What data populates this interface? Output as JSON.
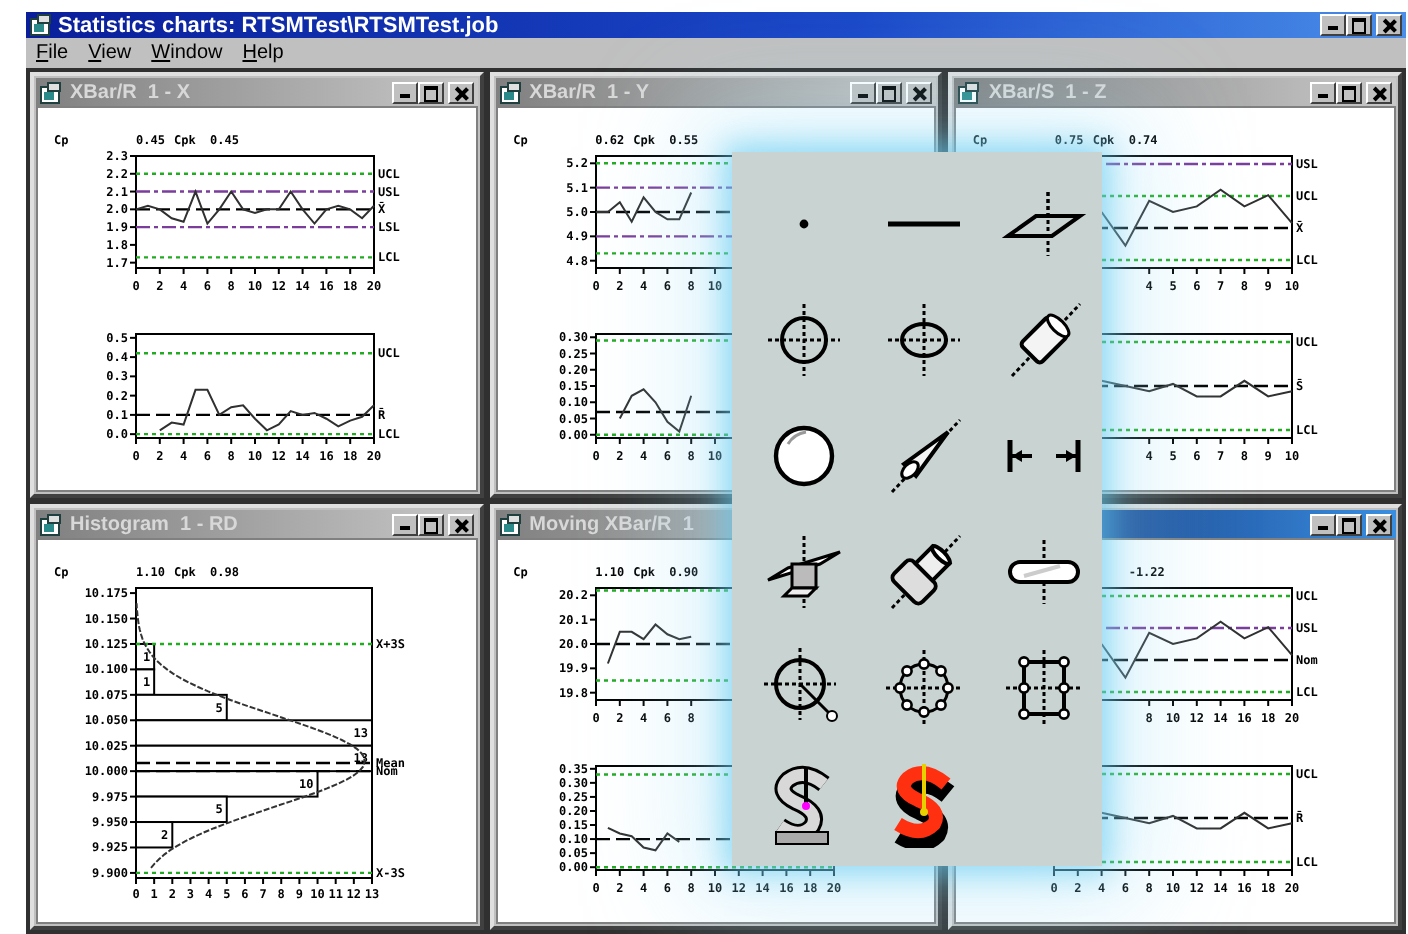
{
  "window": {
    "title": "Statistics charts: RTSMTest\\RTSMTest.job"
  },
  "menu": [
    "File",
    "View",
    "Window",
    "Help"
  ],
  "chart_windows": [
    {
      "title": "XBar/R  1 - X",
      "active": false,
      "stats": {
        "cp_label": "Cp",
        "cp": "0.45",
        "cpk_label": "Cpk",
        "cpk": "0.45"
      },
      "charts": [
        {
          "kind": "chart",
          "chart_data": {
            "type": "line",
            "x": [
              0,
              1,
              2,
              3,
              4,
              5,
              6,
              7,
              8,
              9,
              10,
              11,
              12,
              13,
              14,
              15,
              16,
              17,
              18,
              19,
              20
            ],
            "xlim": [
              0,
              20
            ],
            "ylim": [
              1.67,
              2.3
            ],
            "xticks": [
              0,
              2,
              4,
              6,
              8,
              10,
              12,
              14,
              16,
              18,
              20
            ],
            "yticks": [
              {
                "value": 2.3,
                "label": "2.3"
              },
              {
                "value": 2.2,
                "label": "2.2"
              },
              {
                "value": 2.1,
                "label": "2.1"
              },
              {
                "value": 2.0,
                "label": "2.0"
              },
              {
                "value": 1.9,
                "label": "1.9"
              },
              {
                "value": 1.8,
                "label": "1.8"
              },
              {
                "value": 1.7,
                "label": "1.7"
              }
            ],
            "series": [
              {
                "color": "#303030",
                "values": [
                  2.0,
                  2.02,
                  2.0,
                  1.95,
                  1.93,
                  2.1,
                  1.92,
                  2.0,
                  2.1,
                  2.0,
                  1.98,
                  2.0,
                  2.0,
                  2.1,
                  2.0,
                  1.92,
                  2.0,
                  2.02,
                  2.0,
                  1.95,
                  2.02
                ]
              }
            ],
            "ref_lines": [
              {
                "axis": "y",
                "value": 2.2,
                "label": "UCL",
                "color": "#22aa22"
              },
              {
                "axis": "y",
                "value": 2.1,
                "label": "USL",
                "color": "#7a3d9a"
              },
              {
                "axis": "y",
                "value": 2.0,
                "label": "X̄",
                "color": "#000000"
              },
              {
                "axis": "y",
                "value": 1.9,
                "label": "LSL",
                "color": "#7a3d9a"
              },
              {
                "axis": "y",
                "value": 1.73,
                "label": "LCL",
                "color": "#22aa22"
              }
            ]
          }
        },
        {
          "kind": "chart",
          "chart_data": {
            "type": "line",
            "x": [
              2,
              3,
              4,
              5,
              6,
              7,
              8,
              9,
              10,
              11,
              12,
              13,
              14,
              15,
              16,
              17,
              18,
              19,
              20
            ],
            "xlim": [
              0,
              20
            ],
            "ylim": [
              -0.02,
              0.52
            ],
            "xticks": [
              0,
              2,
              4,
              6,
              8,
              10,
              12,
              14,
              16,
              18,
              20
            ],
            "yticks": [
              {
                "value": 0.5,
                "label": "0.5"
              },
              {
                "value": 0.4,
                "label": "0.4"
              },
              {
                "value": 0.3,
                "label": "0.3"
              },
              {
                "value": 0.2,
                "label": "0.2"
              },
              {
                "value": 0.1,
                "label": "0.1"
              },
              {
                "value": 0.0,
                "label": "0.0"
              }
            ],
            "series": [
              {
                "color": "#303030",
                "values": [
                  0.02,
                  0.06,
                  0.05,
                  0.23,
                  0.23,
                  0.1,
                  0.14,
                  0.15,
                  0.08,
                  0.02,
                  0.05,
                  0.12,
                  0.1,
                  0.11,
                  0.08,
                  0.04,
                  0.07,
                  0.09,
                  0.15
                ]
              }
            ],
            "ref_lines": [
              {
                "axis": "y",
                "value": 0.42,
                "label": "UCL",
                "color": "#22aa22"
              },
              {
                "axis": "y",
                "value": 0.1,
                "label": "R̄",
                "color": "#000000"
              },
              {
                "axis": "y",
                "value": 0.0,
                "label": "LCL",
                "color": "#22aa22"
              }
            ]
          }
        }
      ]
    },
    {
      "title": "XBar/R  1 - Y",
      "active": false,
      "stats": {
        "cp_label": "Cp",
        "cp": "0.62",
        "cpk_label": "Cpk",
        "cpk": "0.55"
      },
      "charts": [
        {
          "kind": "chart",
          "chart_data": {
            "type": "line",
            "x": [
              0,
              1,
              2,
              3,
              4,
              5,
              6,
              7,
              8
            ],
            "xlim": [
              0,
              20
            ],
            "ylim": [
              4.77,
              5.23
            ],
            "xticks": [
              0,
              2,
              4,
              6,
              8,
              10
            ],
            "yticks": [
              {
                "value": 5.2,
                "label": "5.2"
              },
              {
                "value": 5.1,
                "label": "5.1"
              },
              {
                "value": 5.0,
                "label": "5.0"
              },
              {
                "value": 4.9,
                "label": "4.9"
              },
              {
                "value": 4.8,
                "label": "4.8"
              }
            ],
            "series": [
              {
                "color": "#303030",
                "values": [
                  5.0,
                  5.0,
                  5.04,
                  4.96,
                  5.06,
                  5.0,
                  4.97,
                  4.97,
                  5.08
                ]
              }
            ],
            "ref_lines": [
              {
                "axis": "y",
                "value": 5.2,
                "color": "#22aa22"
              },
              {
                "axis": "y",
                "value": 5.1,
                "color": "#7a3d9a"
              },
              {
                "axis": "y",
                "value": 5.0,
                "color": "#000000"
              },
              {
                "axis": "y",
                "value": 4.9,
                "color": "#7a3d9a"
              },
              {
                "axis": "y",
                "value": 4.83,
                "color": "#22aa22"
              }
            ]
          }
        },
        {
          "kind": "chart",
          "chart_data": {
            "type": "line",
            "x": [
              2,
              3,
              4,
              5,
              6,
              7,
              8
            ],
            "xlim": [
              0,
              20
            ],
            "ylim": [
              -0.01,
              0.31
            ],
            "xticks": [
              0,
              2,
              4,
              6,
              8,
              10
            ],
            "yticks": [
              {
                "value": 0.3,
                "label": "0.30"
              },
              {
                "value": 0.25,
                "label": "0.25"
              },
              {
                "value": 0.2,
                "label": "0.20"
              },
              {
                "value": 0.15,
                "label": "0.15"
              },
              {
                "value": 0.1,
                "label": "0.10"
              },
              {
                "value": 0.05,
                "label": "0.05"
              },
              {
                "value": 0.0,
                "label": "0.00"
              }
            ],
            "series": [
              {
                "color": "#303030",
                "values": [
                  0.05,
                  0.12,
                  0.14,
                  0.1,
                  0.04,
                  0.01,
                  0.12
                ]
              }
            ],
            "ref_lines": [
              {
                "axis": "y",
                "value": 0.29,
                "color": "#22aa22"
              },
              {
                "axis": "y",
                "value": 0.07,
                "color": "#000000"
              },
              {
                "axis": "y",
                "value": 0.0,
                "color": "#22aa22"
              }
            ]
          }
        }
      ]
    },
    {
      "title": "XBar/S  1 - Z",
      "active": false,
      "stats": {
        "cp_label": "Cp",
        "cp": "0.75",
        "cpk_label": "Cpk",
        "cpk": "0.74"
      },
      "charts": [
        {
          "kind": "trace",
          "xticks": [
            "4",
            "5",
            "6",
            "7",
            "8",
            "9",
            "10"
          ],
          "limits": [
            {
              "label": "USL",
              "kind": "spec"
            },
            {
              "label": "UCL",
              "kind": "control"
            },
            {
              "label": "X̄",
              "kind": "center"
            },
            {
              "label": "LCL",
              "kind": "control"
            }
          ]
        },
        {
          "kind": "trace",
          "xticks": [
            "4",
            "5",
            "6",
            "7",
            "8",
            "9",
            "10"
          ],
          "limits": [
            {
              "label": "UCL",
              "kind": "control"
            },
            {
              "label": "S̄",
              "kind": "center"
            },
            {
              "label": "LCL",
              "kind": "control"
            }
          ]
        }
      ]
    },
    {
      "title": "Histogram  1 - RD",
      "active": false,
      "stats": {
        "cp_label": "Cp",
        "cp": "1.10",
        "cpk_label": "Cpk",
        "cpk": "0.98"
      },
      "charts": [
        {
          "kind": "chart",
          "chart_data": {
            "type": "bar",
            "orientation": "horizontal",
            "data_labels": true,
            "x": [
              10.1125,
              10.0875,
              10.0625,
              10.0375,
              10.0125,
              9.9875,
              9.9625,
              9.9375
            ],
            "values": [
              1,
              1,
              5,
              13,
              13,
              10,
              5,
              2
            ],
            "xlim": [
              0,
              13
            ],
            "ylim": [
              9.895,
              10.18
            ],
            "xticks": [
              0,
              1,
              2,
              3,
              4,
              5,
              6,
              7,
              8,
              9,
              10,
              11,
              12,
              13
            ],
            "yticks": [
              {
                "value": 10.175,
                "label": "10.175"
              },
              {
                "value": 10.15,
                "label": "10.150"
              },
              {
                "value": 10.125,
                "label": "10.125"
              },
              {
                "value": 10.1,
                "label": "10.100"
              },
              {
                "value": 10.075,
                "label": "10.075"
              },
              {
                "value": 10.05,
                "label": "10.050"
              },
              {
                "value": 10.025,
                "label": "10.025"
              },
              {
                "value": 10.0,
                "label": "10.000"
              },
              {
                "value": 9.975,
                "label": "9.975"
              },
              {
                "value": 9.95,
                "label": "9.950"
              },
              {
                "value": 9.925,
                "label": "9.925"
              },
              {
                "value": 9.9,
                "label": "9.900"
              }
            ],
            "ref_lines": [
              {
                "axis": "y",
                "value": 10.125,
                "label": "X+3S",
                "color": "#22aa22"
              },
              {
                "axis": "y",
                "value": 10.008,
                "label": "Mean",
                "color": "#000000"
              },
              {
                "axis": "y",
                "value": 10.0,
                "label": "Nom",
                "color": "#000000"
              },
              {
                "axis": "y",
                "value": 9.9,
                "label": "X-3S",
                "color": "#22aa22"
              }
            ]
          }
        }
      ]
    },
    {
      "title": "Moving XBar/R  1",
      "active": false,
      "stats": {
        "cp_label": "Cp",
        "cp": "1.10",
        "cpk_label": "Cpk",
        "cpk": "0.90"
      },
      "charts": [
        {
          "kind": "chart",
          "chart_data": {
            "type": "line",
            "x": [
              1,
              2,
              3,
              4,
              5,
              6,
              7,
              8
            ],
            "xlim": [
              0,
              20
            ],
            "ylim": [
              19.77,
              20.23
            ],
            "xticks": [
              0,
              2,
              4,
              6,
              8
            ],
            "yticks": [
              {
                "value": 20.2,
                "label": "20.2"
              },
              {
                "value": 20.1,
                "label": "20.1"
              },
              {
                "value": 20.0,
                "label": "20.0"
              },
              {
                "value": 19.9,
                "label": "19.9"
              },
              {
                "value": 19.8,
                "label": "19.8"
              }
            ],
            "series": [
              {
                "color": "#303030",
                "values": [
                  19.92,
                  20.05,
                  20.05,
                  20.02,
                  20.08,
                  20.04,
                  20.02,
                  20.03
                ]
              }
            ],
            "ref_lines": [
              {
                "axis": "y",
                "value": 20.22,
                "color": "#22aa22"
              },
              {
                "axis": "y",
                "value": 20.0,
                "color": "#000000"
              },
              {
                "axis": "y",
                "value": 19.85,
                "color": "#22aa22"
              }
            ]
          }
        },
        {
          "kind": "chart",
          "chart_data": {
            "type": "line",
            "x": [
              1,
              2,
              3,
              4,
              5,
              6,
              7
            ],
            "xlim": [
              0,
              20
            ],
            "ylim": [
              -0.01,
              0.36
            ],
            "xticks": [
              0,
              2,
              4,
              6,
              8,
              10,
              12,
              14,
              16,
              18,
              20
            ],
            "yticks": [
              {
                "value": 0.35,
                "label": "0.35"
              },
              {
                "value": 0.3,
                "label": "0.30"
              },
              {
                "value": 0.25,
                "label": "0.25"
              },
              {
                "value": 0.2,
                "label": "0.20"
              },
              {
                "value": 0.15,
                "label": "0.15"
              },
              {
                "value": 0.1,
                "label": "0.10"
              },
              {
                "value": 0.05,
                "label": "0.05"
              },
              {
                "value": 0.0,
                "label": "0.00"
              }
            ],
            "series": [
              {
                "color": "#303030",
                "values": [
                  0.14,
                  0.12,
                  0.11,
                  0.07,
                  0.06,
                  0.12,
                  0.09
                ]
              }
            ],
            "ref_lines": [
              {
                "axis": "y",
                "value": 0.33,
                "color": "#22aa22"
              },
              {
                "axis": "y",
                "value": 0.1,
                "color": "#000000"
              },
              {
                "axis": "y",
                "value": 0.0,
                "color": "#22aa22"
              }
            ]
          }
        }
      ]
    },
    {
      "active": true,
      "stats": {
        "cpk": "-1.22"
      },
      "charts": [
        {
          "kind": "trace",
          "xticks": [
            "8",
            "10",
            "12",
            "14",
            "16",
            "18",
            "20"
          ],
          "limits": [
            {
              "label": "UCL",
              "kind": "control"
            },
            {
              "label": "USL",
              "kind": "spec"
            },
            {
              "label": "Nom",
              "kind": "center"
            },
            {
              "label": "LCL",
              "kind": "control"
            }
          ]
        },
        {
          "kind": "trace",
          "xticks": [
            "0",
            "2",
            "4",
            "6",
            "8",
            "10",
            "12",
            "14",
            "16",
            "18",
            "20"
          ],
          "limits": [
            {
              "label": "UCL",
              "kind": "control"
            },
            {
              "label": "R̄",
              "kind": "center"
            },
            {
              "label": "LCL",
              "kind": "control"
            }
          ]
        }
      ]
    }
  ]
}
